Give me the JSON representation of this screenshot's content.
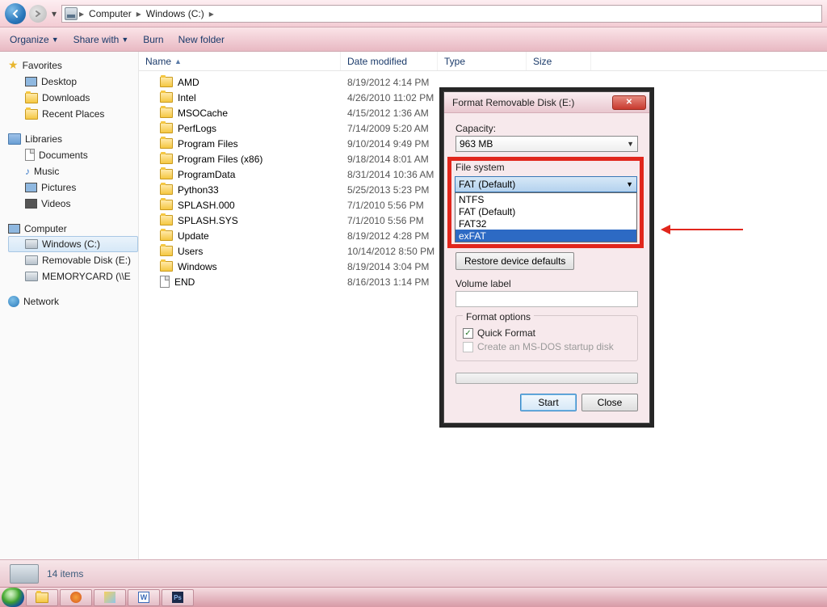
{
  "breadcrumb": {
    "root": "Computer",
    "current": "Windows (C:)"
  },
  "toolbar": {
    "organize": "Organize",
    "share": "Share with",
    "burn": "Burn",
    "newfolder": "New folder"
  },
  "sidebar": {
    "favorites": {
      "title": "Favorites",
      "items": [
        "Desktop",
        "Downloads",
        "Recent Places"
      ]
    },
    "libraries": {
      "title": "Libraries",
      "items": [
        "Documents",
        "Music",
        "Pictures",
        "Videos"
      ]
    },
    "computer": {
      "title": "Computer",
      "items": [
        "Windows (C:)",
        "Removable Disk (E:)",
        "MEMORYCARD (\\\\E"
      ]
    },
    "network": {
      "title": "Network"
    }
  },
  "columns": {
    "name": "Name",
    "date": "Date modified",
    "type": "Type",
    "size": "Size"
  },
  "files": [
    {
      "name": "AMD",
      "date": "8/19/2012 4:14 PM",
      "kind": "folder"
    },
    {
      "name": "Intel",
      "date": "4/26/2010 11:02 PM",
      "kind": "folder"
    },
    {
      "name": "MSOCache",
      "date": "4/15/2012 1:36 AM",
      "kind": "folder"
    },
    {
      "name": "PerfLogs",
      "date": "7/14/2009 5:20 AM",
      "kind": "folder"
    },
    {
      "name": "Program Files",
      "date": "9/10/2014 9:49 PM",
      "kind": "folder"
    },
    {
      "name": "Program Files (x86)",
      "date": "9/18/2014 8:01 AM",
      "kind": "folder"
    },
    {
      "name": "ProgramData",
      "date": "8/31/2014 10:36 AM",
      "kind": "folder"
    },
    {
      "name": "Python33",
      "date": "5/25/2013 5:23 PM",
      "kind": "folder"
    },
    {
      "name": "SPLASH.000",
      "date": "7/1/2010 5:56 PM",
      "kind": "folder"
    },
    {
      "name": "SPLASH.SYS",
      "date": "7/1/2010 5:56 PM",
      "kind": "folder"
    },
    {
      "name": "Update",
      "date": "8/19/2012 4:28 PM",
      "kind": "folder"
    },
    {
      "name": "Users",
      "date": "10/14/2012 8:50 PM",
      "kind": "folder"
    },
    {
      "name": "Windows",
      "date": "8/19/2014 3:04 PM",
      "kind": "folder"
    },
    {
      "name": "END",
      "date": "8/16/2013 1:14 PM",
      "kind": "file"
    }
  ],
  "status": {
    "count": "14 items"
  },
  "dialog": {
    "title": "Format Removable Disk (E:)",
    "capacity_label": "Capacity:",
    "capacity_value": "963 MB",
    "fs_label": "File system",
    "fs_value": "FAT (Default)",
    "fs_options": [
      "NTFS",
      "FAT (Default)",
      "FAT32",
      "exFAT"
    ],
    "fs_selected_index": 3,
    "restore": "Restore device defaults",
    "vol_label": "Volume label",
    "vol_value": "",
    "options_label": "Format options",
    "quick": "Quick Format",
    "msdos": "Create an MS-DOS startup disk",
    "start": "Start",
    "close": "Close"
  },
  "annotation": {
    "red_highlight_target": "file-system-dropdown"
  }
}
